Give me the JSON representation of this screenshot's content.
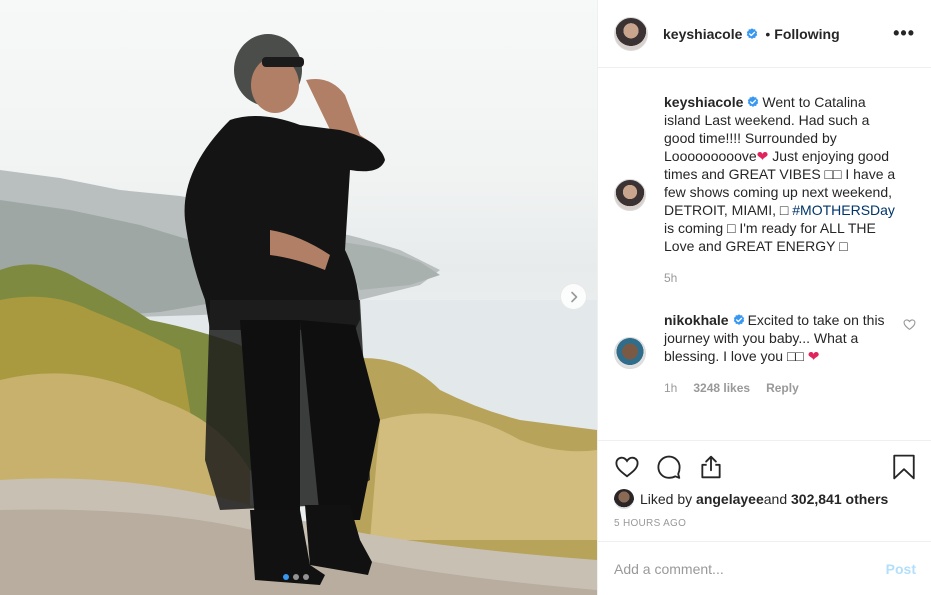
{
  "header": {
    "username": "keyshiacole",
    "separator": "•",
    "follow_state": "Following",
    "more_label": "•••"
  },
  "caption": {
    "username": "keyshiacole",
    "text_part1": "Went to Catalina island Last weekend. Had such a good time!!!! Surrounded by Looooooooove",
    "text_part2": " Just enjoying good times and GREAT VIBES □□ I have a few shows coming up next weekend, DETROIT, MIAMI, □ ",
    "hashtag": "#MOTHERSDay",
    "text_part3": " is coming □ I'm ready for ALL THE Love and GREAT ENERGY □",
    "heart": "❤",
    "time": "5h"
  },
  "reply": {
    "username": "nikokhale",
    "text": "Excited to take on this journey with you baby... What a blessing. I love you □□ ",
    "heart": "❤",
    "time": "1h",
    "likes": "3248 likes",
    "reply_label": "Reply"
  },
  "actions": {
    "liked_by_prefix": "Liked by ",
    "liked_by_user": "angelayee",
    "liked_by_connector": " and ",
    "liked_by_others": "302,841 others",
    "time_ago": "5 HOURS AGO"
  },
  "add_comment": {
    "placeholder": "Add a comment...",
    "post_label": "Post"
  },
  "icons": {
    "verified": "verified-badge-icon",
    "like": "heart-outline-icon",
    "comment": "speech-bubble-icon",
    "share": "share-upload-icon",
    "save": "bookmark-icon",
    "next": "chevron-right-icon"
  },
  "carousel": {
    "current": 1,
    "total": 3
  },
  "colors": {
    "accent": "#3897f0",
    "hashtag": "#003569",
    "post_disabled": "#b2dffc",
    "heart": "#e0245e"
  }
}
